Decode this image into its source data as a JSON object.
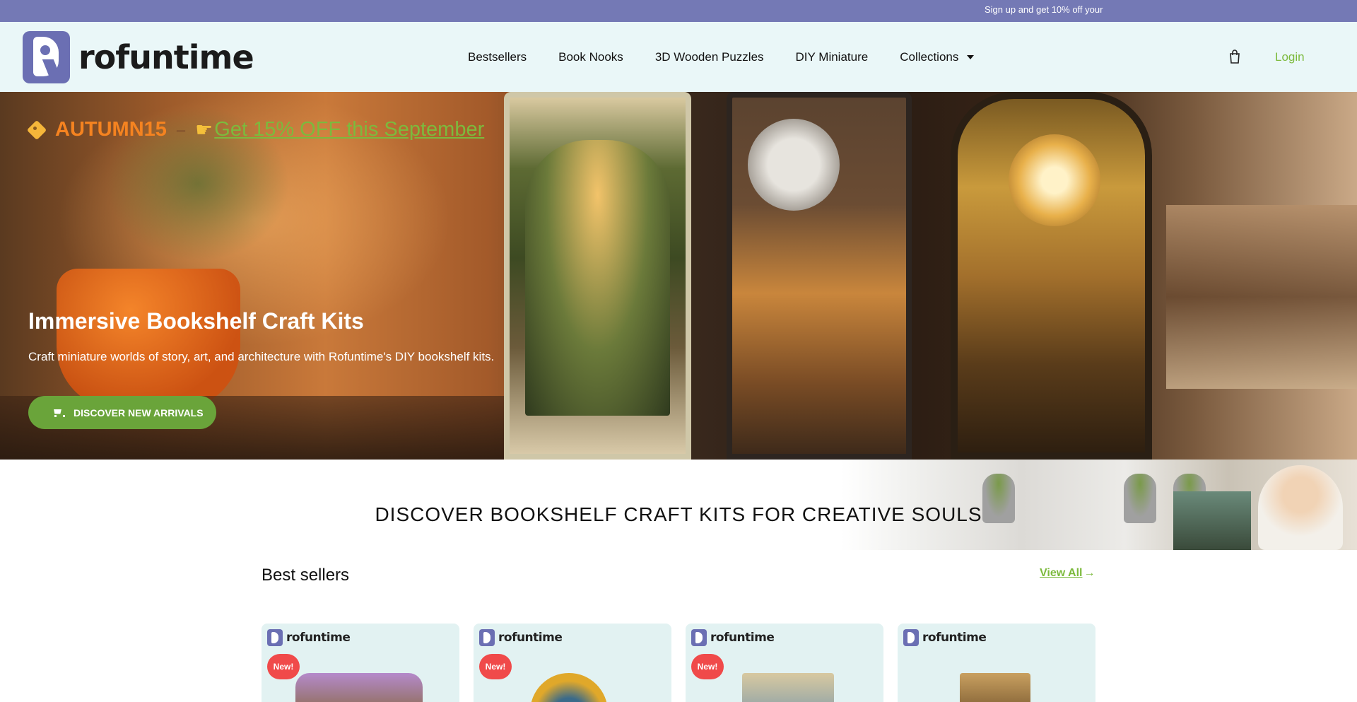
{
  "announcement": {
    "text": "Sign up and get 10% off your"
  },
  "header": {
    "logo_text": "rofuntime",
    "nav": [
      {
        "label": "Bestsellers"
      },
      {
        "label": "Book Nooks"
      },
      {
        "label": "3D Wooden Puzzles"
      },
      {
        "label": "DIY Miniature"
      },
      {
        "label": "Collections",
        "has_dropdown": true
      }
    ],
    "cart_icon": "shopping-bag-icon",
    "login_label": "Login"
  },
  "hero": {
    "promo_code": "AUTUMN15",
    "promo_separator": "–",
    "promo_link": "Get 15% OFF this September",
    "title": "Immersive Bookshelf Craft Kits",
    "subtitle": "Craft miniature worlds of story, art, and architecture with Rofuntime's DIY bookshelf kits.",
    "cta_label": "DISCOVER NEW ARRIVALS"
  },
  "discover": {
    "heading": "DISCOVER BOOKSHELF CRAFT KITS FOR CREATIVE SOULS"
  },
  "best_sellers": {
    "title": "Best sellers",
    "view_all": "View All",
    "view_all_arrow": "→",
    "cards": [
      {
        "brand": "rofuntime",
        "badge": "New!"
      },
      {
        "brand": "rofuntime",
        "badge": "New!"
      },
      {
        "brand": "rofuntime",
        "badge": "New!"
      },
      {
        "brand": "rofuntime",
        "badge": ""
      }
    ]
  },
  "colors": {
    "announcement_bg": "#7479b5",
    "header_bg": "#eaf7f8",
    "accent_green": "#7cba3d",
    "promo_orange": "#f58320",
    "badge_red": "#f04a4a",
    "card_bg": "#e2f2f2"
  }
}
